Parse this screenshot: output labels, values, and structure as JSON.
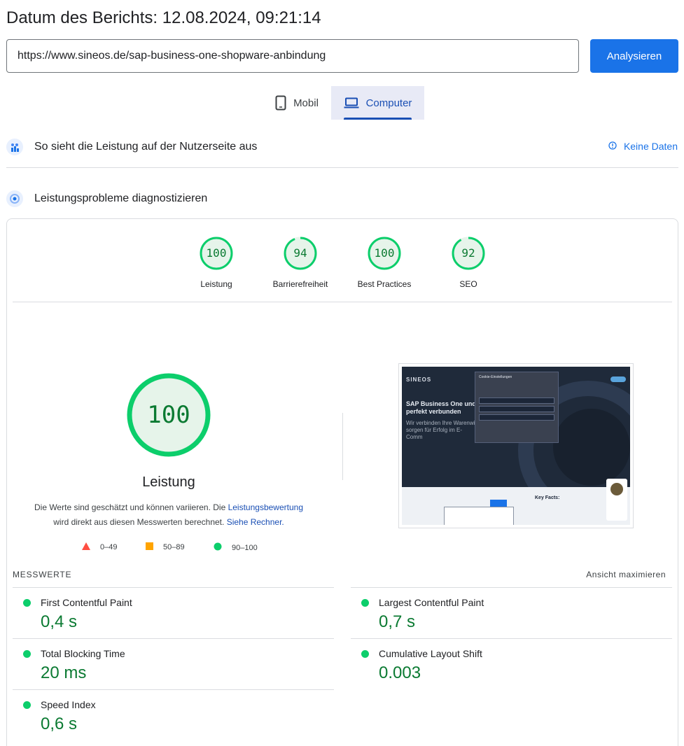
{
  "header": {
    "report_date": "Datum des Berichts: 12.08.2024, 09:21:14"
  },
  "search": {
    "url_value": "https://www.sineos.de/sap-business-one-shopware-anbindung",
    "analyze_label": "Analysieren"
  },
  "device_tabs": {
    "mobile_label": "Mobil",
    "desktop_label": "Computer",
    "selected": "Computer"
  },
  "field_data": {
    "title": "So sieht die Leistung auf der Nutzerseite aus",
    "no_data_label": "Keine Daten"
  },
  "lab_data": {
    "title": "Leistungsprobleme diagnostizieren"
  },
  "scores": [
    {
      "label": "Leistung",
      "value": "100",
      "fraction": 1.0
    },
    {
      "label": "Barrierefreiheit",
      "value": "94",
      "fraction": 0.94
    },
    {
      "label": "Best Practices",
      "value": "100",
      "fraction": 1.0
    },
    {
      "label": "SEO",
      "value": "92",
      "fraction": 0.92
    }
  ],
  "performance": {
    "score": "100",
    "title": "Leistung",
    "note_part1": "Die Werte sind geschätzt und können variieren. Die ",
    "note_link1": "Leistungsbewertung",
    "note_part2": " wird direkt aus diesen Messwerten berechnet. ",
    "note_link2": "Siehe Rechner.",
    "legend": {
      "fail": "0–49",
      "average": "50–89",
      "pass": "90–100"
    }
  },
  "screenshot": {
    "logo": "SINEOS",
    "headline": "SAP Business One und perfekt verbunden",
    "sub": "Wir verbinden Ihre Warenwi sorgen für Erfolg im E-Comm",
    "cookie_title": "Cookie-Einstellungen",
    "key_facts": "Key Facts:"
  },
  "metrics": {
    "heading": "MESSWERTE",
    "expand_label": "Ansicht maximieren",
    "items": [
      {
        "name": "First Contentful Paint",
        "value": "0,4 s"
      },
      {
        "name": "Largest Contentful Paint",
        "value": "0,7 s"
      },
      {
        "name": "Total Blocking Time",
        "value": "20 ms"
      },
      {
        "name": "Cumulative Layout Shift",
        "value": "0.003"
      },
      {
        "name": "Speed Index",
        "value": "0,6 s"
      }
    ]
  },
  "colors": {
    "pass": "#0cce6b",
    "pass_text": "#0b7a32",
    "average": "#ffa400",
    "fail": "#ff4e42",
    "accent": "#1a73e8"
  }
}
